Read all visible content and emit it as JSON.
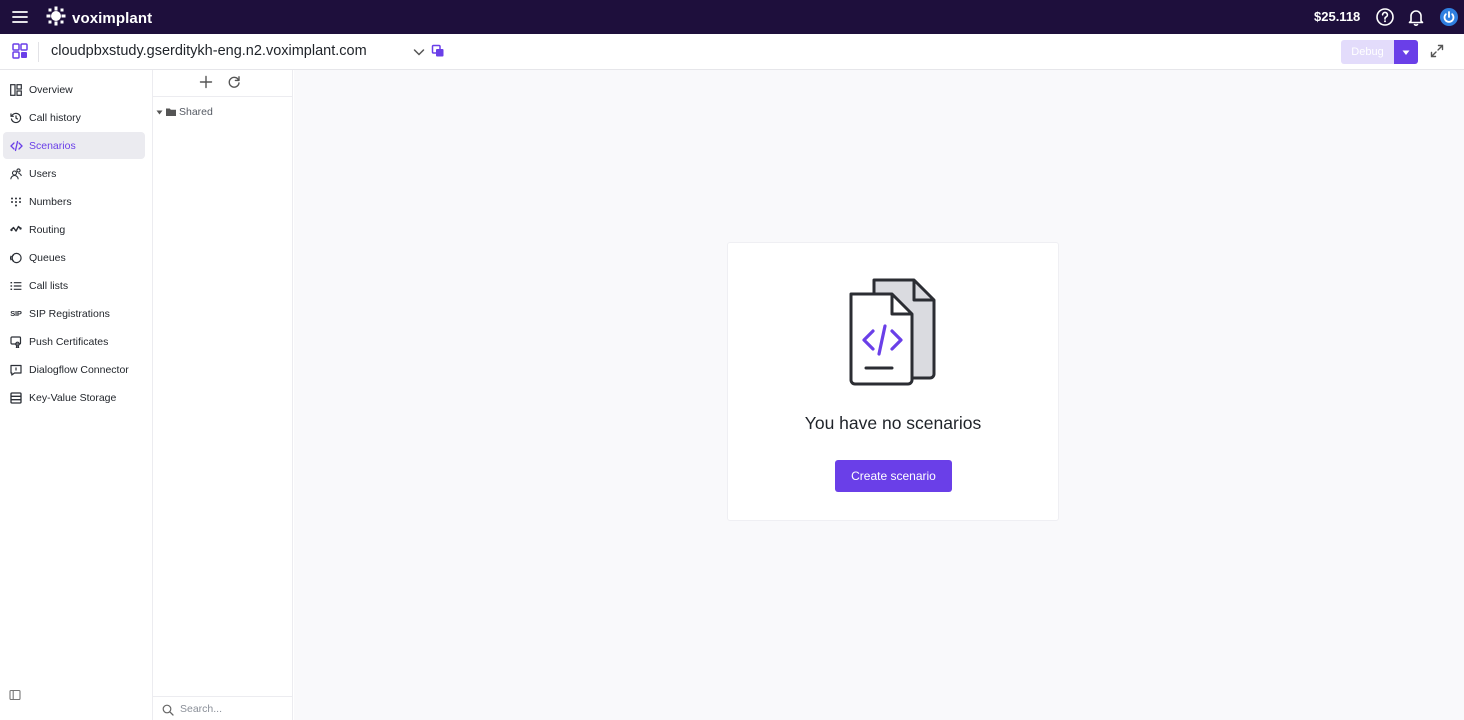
{
  "topbar": {
    "brand": "voximplant",
    "balance": "$25.118",
    "icons": [
      "menu-icon",
      "voximplant-logo-icon",
      "help-icon",
      "bell-icon",
      "power-icon"
    ]
  },
  "appbar": {
    "app_name": "cloudpbxstudy.gserditykh-eng.n2.voximplant.com",
    "debug_label": "Debug",
    "icons": [
      "apps-icon",
      "chevron-down-icon",
      "copy-icon",
      "caret-down-icon",
      "expand-icon"
    ]
  },
  "nav": {
    "items": [
      {
        "label": "Overview",
        "icon": "dashboard-icon",
        "active": false
      },
      {
        "label": "Call history",
        "icon": "history-icon",
        "active": false
      },
      {
        "label": "Scenarios",
        "icon": "code-icon",
        "active": true
      },
      {
        "label": "Users",
        "icon": "users-icon",
        "active": false
      },
      {
        "label": "Numbers",
        "icon": "dialpad-icon",
        "active": false
      },
      {
        "label": "Routing",
        "icon": "routing-icon",
        "active": false
      },
      {
        "label": "Queues",
        "icon": "queues-icon",
        "active": false
      },
      {
        "label": "Call lists",
        "icon": "list-icon",
        "active": false
      },
      {
        "label": "SIP Registrations",
        "icon": "sip-icon",
        "active": false
      },
      {
        "label": "Push Certificates",
        "icon": "certificate-icon",
        "active": false
      },
      {
        "label": "Dialogflow Connector",
        "icon": "chat-icon",
        "active": false
      },
      {
        "label": "Key-Value Storage",
        "icon": "storage-icon",
        "active": false
      }
    ],
    "sip_glyph": "SIP"
  },
  "files": {
    "folder_label": "Shared",
    "search_placeholder": "Search..."
  },
  "main": {
    "empty_title": "You have no scenarios",
    "create_label": "Create scenario"
  },
  "colors": {
    "topbar_bg": "#1e0f3c",
    "accent": "#6a3fe8",
    "debug_disabled": "#e3dcfb",
    "active_nav_bg": "#ebebf0",
    "main_bg": "#f9f9fb"
  }
}
